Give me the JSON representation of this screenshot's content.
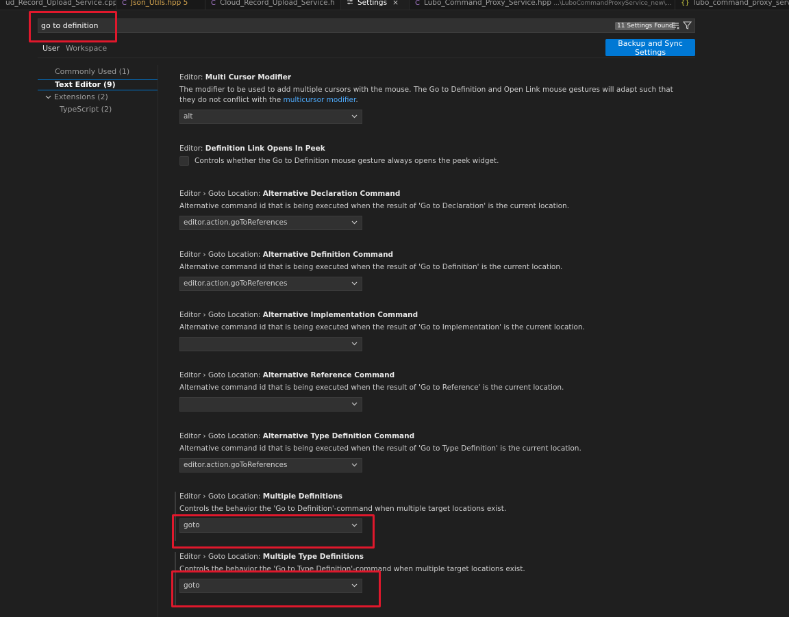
{
  "tabs": [
    {
      "label": "ud_Record_Upload_Service.cpp",
      "icon": "",
      "active": false
    },
    {
      "label": "Json_Utils.hpp",
      "modified": "5",
      "icon": "C"
    },
    {
      "label": "Cloud_Record_Upload_Service.h",
      "icon": "C"
    },
    {
      "label": "Settings",
      "icon": "settings-icon",
      "active": true,
      "close": "×"
    },
    {
      "label": "Lubo_Command_Proxy_Service.hpp",
      "path": "...\\LuboCommandProxyService_new\\...",
      "icon": "C"
    },
    {
      "label": "lubo_command_proxy_servi",
      "icon": "{}"
    }
  ],
  "search": {
    "value": "go to definition",
    "results": "11 Settings Found"
  },
  "scope": {
    "user": "User",
    "workspace": "Workspace"
  },
  "sync_button": "Backup and Sync Settings",
  "toc": {
    "commonly_used": {
      "label": "Commonly Used",
      "count": "(1)"
    },
    "text_editor": {
      "label": "Text Editor",
      "count": "(9)"
    },
    "extensions": {
      "label": "Extensions",
      "count": "(2)"
    },
    "typescript": {
      "label": "TypeScript",
      "count": "(2)"
    }
  },
  "settings": [
    {
      "prefix": "Editor: ",
      "name": "Multi Cursor Modifier",
      "desc_before": "The modifier to be used to add multiple cursors with the mouse. The Go to Definition and Open Link mouse gestures will adapt such that they do not conflict with the ",
      "desc_link": "multicursor modifier",
      "desc_after": ".",
      "value": "alt"
    },
    {
      "prefix": "Editor: ",
      "name": "Definition Link Opens In Peek",
      "desc": "Controls whether the Go to Definition mouse gesture always opens the peek widget."
    },
    {
      "prefix": "Editor › Goto Location: ",
      "name": "Alternative Declaration Command",
      "desc": "Alternative command id that is being executed when the result of 'Go to Declaration' is the current location.",
      "value": "editor.action.goToReferences"
    },
    {
      "prefix": "Editor › Goto Location: ",
      "name": "Alternative Definition Command",
      "desc": "Alternative command id that is being executed when the result of 'Go to Definition' is the current location.",
      "value": "editor.action.goToReferences"
    },
    {
      "prefix": "Editor › Goto Location: ",
      "name": "Alternative Implementation Command",
      "desc": "Alternative command id that is being executed when the result of 'Go to Implementation' is the current location.",
      "value": ""
    },
    {
      "prefix": "Editor › Goto Location: ",
      "name": "Alternative Reference Command",
      "desc": "Alternative command id that is being executed when the result of 'Go to Reference' is the current location.",
      "value": ""
    },
    {
      "prefix": "Editor › Goto Location: ",
      "name": "Alternative Type Definition Command",
      "desc": "Alternative command id that is being executed when the result of 'Go to Type Definition' is the current location.",
      "value": "editor.action.goToReferences"
    },
    {
      "prefix": "Editor › Goto Location: ",
      "name": "Multiple Definitions",
      "desc": "Controls the behavior the 'Go to Definition'-command when multiple target locations exist.",
      "value": "goto"
    },
    {
      "prefix": "Editor › Goto Location: ",
      "name": "Multiple Type Definitions",
      "desc": "Controls the behavior the 'Go to Type Definition'-command when multiple target locations exist.",
      "value": "goto"
    }
  ],
  "colors": {
    "accent": "#0078d4",
    "annotation": "#e0182c",
    "link": "#4daafc"
  }
}
